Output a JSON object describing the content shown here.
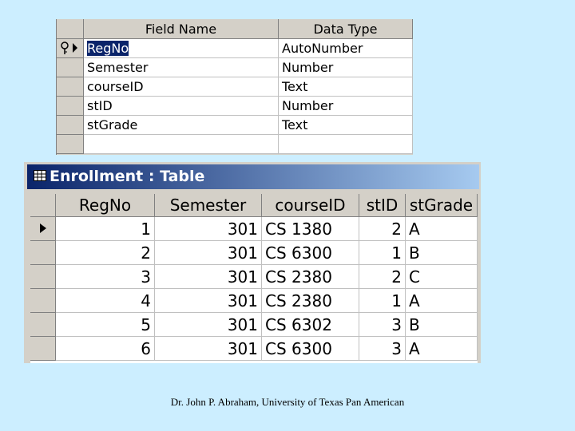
{
  "design_view": {
    "headers": [
      "Field Name",
      "Data Type"
    ],
    "fields": [
      {
        "name": "RegNo",
        "type": "AutoNumber",
        "primary_key": true
      },
      {
        "name": "Semester",
        "type": "Number"
      },
      {
        "name": "courseID",
        "type": "Text"
      },
      {
        "name": "stID",
        "type": "Number"
      },
      {
        "name": "stGrade",
        "type": "Text"
      }
    ]
  },
  "datasheet": {
    "title": "Enrollment : Table",
    "columns": [
      "RegNo",
      "Semester",
      "courseID",
      "stID",
      "stGrade"
    ],
    "rows": [
      [
        "1",
        "301",
        "CS 1380",
        "2",
        "A"
      ],
      [
        "2",
        "301",
        "CS 6300",
        "1",
        "B"
      ],
      [
        "3",
        "301",
        "CS 2380",
        "2",
        "C"
      ],
      [
        "4",
        "301",
        "CS 2380",
        "1",
        "A"
      ],
      [
        "5",
        "301",
        "CS 6302",
        "3",
        "B"
      ],
      [
        "6",
        "301",
        "CS 6300",
        "3",
        "A"
      ]
    ]
  },
  "caption": "Dr. John P. Abraham, University of Texas Pan American",
  "colors": {
    "background": "#cceeff",
    "titlebar_start": "#0a246a",
    "titlebar_end": "#a6caf0",
    "chrome": "#d4d0c8"
  },
  "icons": [
    "key-icon",
    "record-pointer-icon",
    "table-icon"
  ]
}
